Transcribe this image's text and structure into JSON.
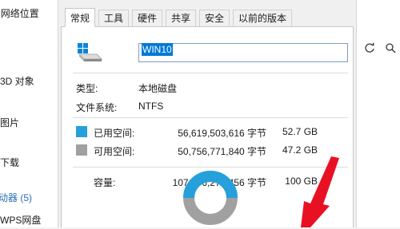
{
  "explorer": {
    "location_prefix": "\\",
    "location_label": "网络位置",
    "nav_items": [
      "3D 对象",
      "图片",
      "下载",
      "动器 (5)",
      "WPS网盘"
    ]
  },
  "dialog": {
    "tabs": [
      "常规",
      "工具",
      "硬件",
      "共享",
      "安全",
      "以前的版本"
    ],
    "active_tab": "常规",
    "drive_name": "WIN10",
    "type_label": "类型:",
    "type_value": "本地磁盘",
    "fs_label": "文件系统:",
    "fs_value": "NTFS",
    "used_label": "已用空间:",
    "used_bytes": "56,619,503,616 字节",
    "used_size": "52.7 GB",
    "free_label": "可用空间:",
    "free_bytes": "50,756,771,840 字节",
    "free_size": "47.2 GB",
    "capacity_label": "容量:",
    "capacity_bytes": "107,376,275,456 字节",
    "capacity_size": "100 GB"
  },
  "colors": {
    "used": "#26a0da",
    "free": "#a0a0a0",
    "arrow": "#e81123",
    "selection": "#0078d7"
  },
  "icons": {
    "drive": "windows-drive-icon",
    "refresh": "refresh-icon",
    "toolbar_right": "view-icon"
  }
}
